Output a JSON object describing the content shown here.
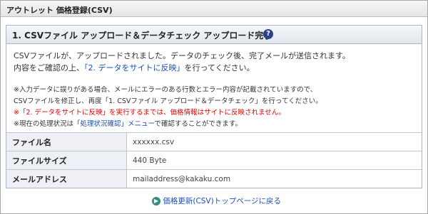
{
  "header": {
    "title": "アウトレット 価格登録(CSV)"
  },
  "panel": {
    "title": "1. CSVファイル アップロード＆データチェック アップロード完了",
    "help_icon": "question-circle-icon",
    "message_line1": "CSVファイルが、アップロードされました。データのチェック後、完了メールが送信されます。",
    "message_line2_before": "内容をご確認の上、",
    "message_line2_link": "「2. データをサイトに反映」",
    "message_line2_after": "を行ってください。",
    "note1": "※入力データに誤りがある場合、メールにエラーのある行数とエラー内容が記載されていますので、",
    "note2": "CSVファイルを修正し、再度「1. CSVファイル アップロード＆データチェック」を行ってください。",
    "note3": "※「2. データをサイトに反映」を実行するまでは、価格情報はサイトに反映されません。",
    "note4_before": "※現在の処理状況は",
    "note4_link": "「処理状況確認」メニュー",
    "note4_after": "で確認することができます。"
  },
  "info_table": {
    "rows": [
      {
        "label": "ファイル名",
        "value": "xxxxxx.csv"
      },
      {
        "label": "ファイルサイズ",
        "value": "440 Byte"
      },
      {
        "label": "メールアドレス",
        "value": "mailaddress@kakaku.com"
      }
    ]
  },
  "footer": {
    "back_link": "価格更新(CSV)トップページに戻る",
    "back_icon": "arrow-right-circle-icon"
  },
  "colors": {
    "accent_link": "#1a4fb5",
    "warning_red": "#e60000",
    "icon_teal": "#2f8f7e",
    "help_navy": "#2b3f8e"
  }
}
